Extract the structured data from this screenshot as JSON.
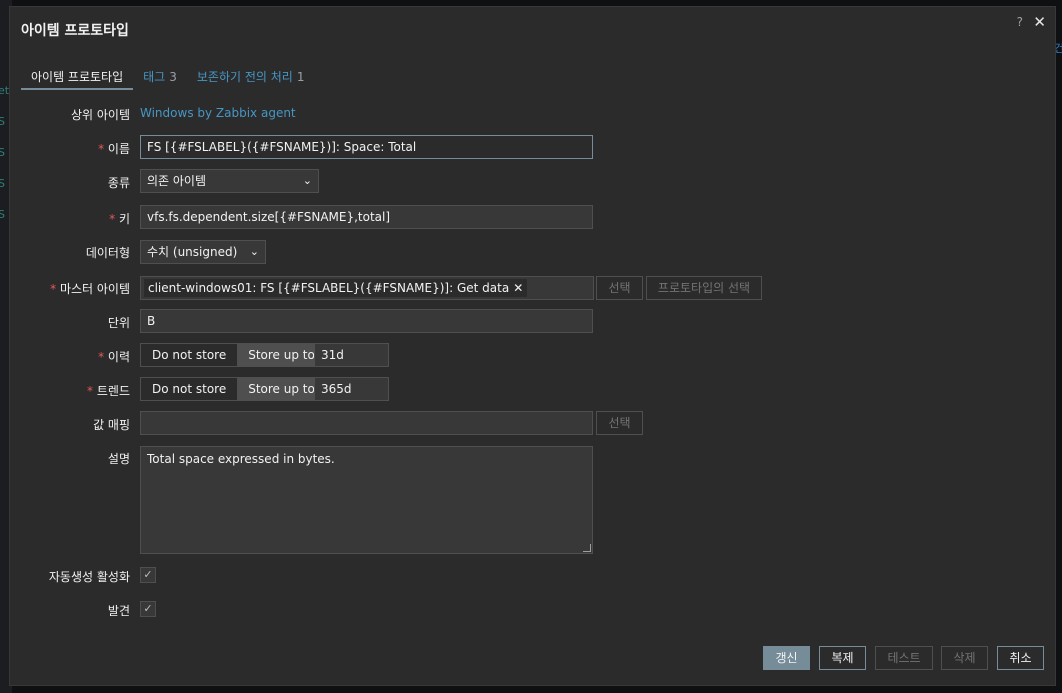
{
  "background": {
    "right_edge_text": "건",
    "left_strip": [
      "et",
      "S",
      "S",
      "S",
      "S"
    ]
  },
  "dialog": {
    "title": "아이템 프로토타입",
    "help_icon": "?",
    "close_icon": "✕"
  },
  "tabs": [
    {
      "label": "아이템 프로토타입",
      "count": ""
    },
    {
      "label": "태그",
      "count": "3"
    },
    {
      "label": "보존하기 전의 처리",
      "count": "1"
    }
  ],
  "form": {
    "parent": {
      "label": "상위 아이템",
      "value": "Windows by Zabbix agent"
    },
    "name": {
      "label": "이름",
      "value": "FS [{#FSLABEL}({#FSNAME})]: Space: Total"
    },
    "type": {
      "label": "종류",
      "value": "의존 아이템"
    },
    "key": {
      "label": "키",
      "value": "vfs.fs.dependent.size[{#FSNAME},total]"
    },
    "datatype": {
      "label": "데이터형",
      "value": "수치 (unsigned)"
    },
    "master": {
      "label": "마스터 아이템",
      "tag": "client-windows01: FS [{#FSLABEL}({#FSNAME})]: Get data",
      "select_label": "선택",
      "select_proto_label": "프로토타입의 선택"
    },
    "units": {
      "label": "단위",
      "value": "B"
    },
    "history": {
      "label": "이력",
      "opt_off": "Do not store",
      "opt_on": "Store up to",
      "value": "31d"
    },
    "trends": {
      "label": "트렌드",
      "opt_off": "Do not store",
      "opt_on": "Store up to",
      "value": "365d"
    },
    "valuemap": {
      "label": "값 매핑",
      "value": "",
      "select_label": "선택"
    },
    "description": {
      "label": "설명",
      "value": "Total space expressed in bytes."
    },
    "discover_enable": {
      "label": "자동생성 활성화",
      "checked": true
    },
    "discover": {
      "label": "발견",
      "checked": true
    },
    "required_mark": "*",
    "check_mark": "✓"
  },
  "footer": {
    "update": "갱신",
    "clone": "복제",
    "test": "테스트",
    "delete": "삭제",
    "cancel": "취소"
  }
}
